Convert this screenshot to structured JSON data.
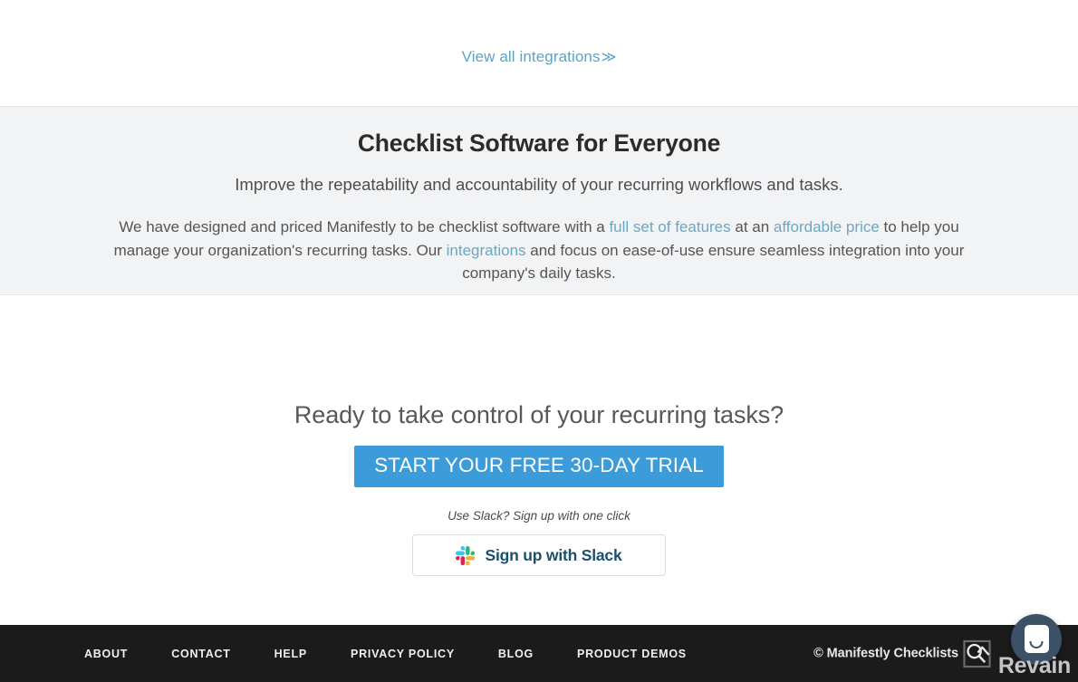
{
  "integrations_strip": {
    "link_label": "View all integrations",
    "chevron": "≫"
  },
  "everyone_section": {
    "title": "Checklist Software for Everyone",
    "subtitle": "Improve the repeatability and accountability of your recurring workflows and tasks.",
    "body": {
      "part1": "We have designed and priced Manifestly to be checklist software with a ",
      "link1": "full set of features",
      "part2": " at an ",
      "link2": "affordable price",
      "part3": " to help you manage your organization's recurring tasks. Our ",
      "link3": "integrations",
      "part4": " and focus on ease-of-use ensure seamless integration into your company's daily tasks."
    },
    "background_color": "#f2f3f5",
    "link_color": "#6aa8c4"
  },
  "cta": {
    "heading": "Ready to take control of your recurring tasks?",
    "trial_button_label": "START YOUR FREE 30-DAY TRIAL",
    "trial_button_color": "#3b9cd9",
    "slack_hint": "Use Slack? Sign up with one click",
    "slack_button_label": "Sign up with Slack",
    "slack_icon": "slack-logo-icon"
  },
  "footer": {
    "background_color": "#1b1b1b",
    "nav": [
      {
        "label": "ABOUT"
      },
      {
        "label": "CONTACT"
      },
      {
        "label": "HELP"
      },
      {
        "label": "PRIVACY POLICY"
      },
      {
        "label": "BLOG"
      },
      {
        "label": "PRODUCT DEMOS"
      }
    ],
    "brand_text": "© Manifestly Checklists",
    "brand_icon": "manifestly-logo-icon"
  },
  "chat_widget": {
    "icon": "chat-smiley-icon",
    "color": "#3d5166"
  },
  "watermark": {
    "text": "Revain"
  }
}
